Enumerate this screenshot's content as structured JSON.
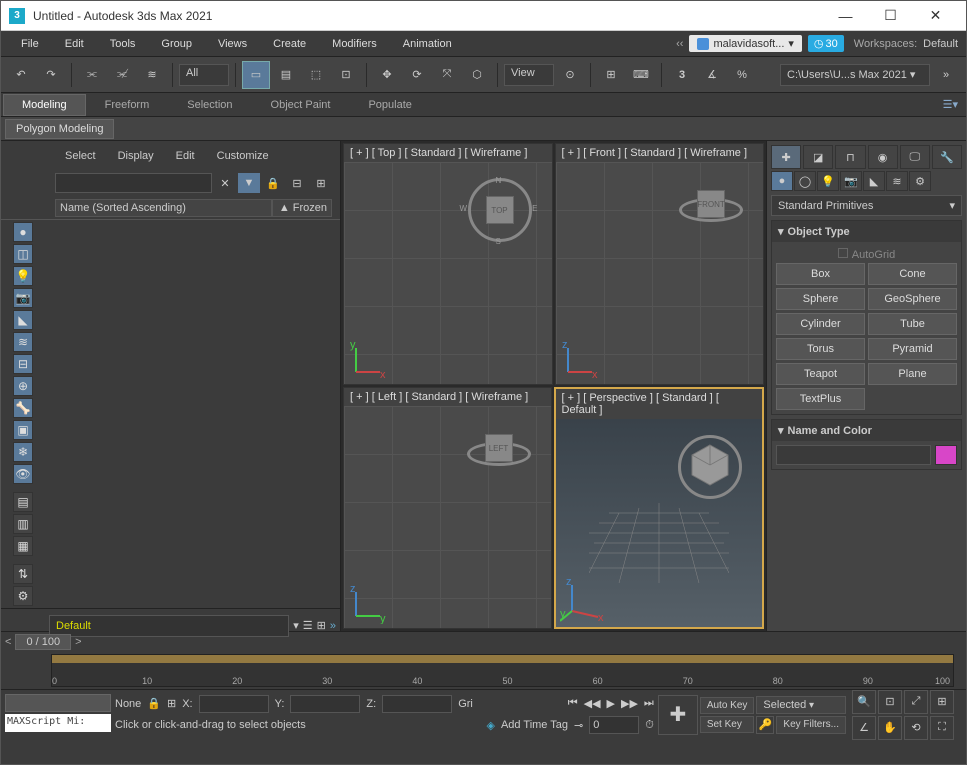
{
  "window": {
    "title": "Untitled - Autodesk 3ds Max 2021"
  },
  "menubar": {
    "items": [
      "File",
      "Edit",
      "Tools",
      "Group",
      "Views",
      "Create",
      "Modifiers",
      "Animation"
    ],
    "user": "malavidasoft...",
    "time": "30",
    "workspaces_label": "Workspaces:",
    "workspace": "Default"
  },
  "toolbar": {
    "selection_set": "All",
    "refcoord": "View",
    "path": "C:\\Users\\U...s Max 2021"
  },
  "ribbon": {
    "tabs": [
      "Modeling",
      "Freeform",
      "Selection",
      "Object Paint",
      "Populate"
    ],
    "active": 0,
    "subtab": "Polygon Modeling"
  },
  "scene_explorer": {
    "menus": [
      "Select",
      "Display",
      "Edit",
      "Customize"
    ],
    "col_name": "Name (Sorted Ascending)",
    "col_frozen": "▲ Frozen",
    "layer": "Default"
  },
  "viewports": {
    "vp": [
      {
        "label": "[ + ] [ Top ] [ Standard ] [ Wireframe ]",
        "cube": "TOP"
      },
      {
        "label": "[ + ] [ Front ] [ Standard ] [ Wireframe ]",
        "cube": "FRONT"
      },
      {
        "label": "[ + ] [ Left ] [ Standard ] [ Wireframe ]",
        "cube": "LEFT"
      },
      {
        "label": "[ + ] [ Perspective ] [ Standard ] [ Default ]",
        "cube": ""
      }
    ]
  },
  "command_panel": {
    "dropdown": "Standard Primitives",
    "rollout_objtype": "Object Type",
    "autogrid": "AutoGrid",
    "primitives": [
      "Box",
      "Cone",
      "Sphere",
      "GeoSphere",
      "Cylinder",
      "Tube",
      "Torus",
      "Pyramid",
      "Teapot",
      "Plane",
      "TextPlus"
    ],
    "rollout_namecolor": "Name and Color",
    "color": "#d846c8"
  },
  "timeline": {
    "pos": "0 / 100",
    "ticks": [
      "0",
      "10",
      "20",
      "30",
      "40",
      "50",
      "60",
      "70",
      "80",
      "90",
      "100"
    ]
  },
  "status": {
    "script": "MAXScript Mi:",
    "none": "None",
    "x": "X:",
    "y": "Y:",
    "z": "Z:",
    "grid": "Gri",
    "prompt": "Click or click-and-drag to select objects",
    "addtag": "Add Time Tag",
    "frame": "0",
    "autokey": "Auto Key",
    "setkey": "Set Key",
    "selected": "Selected",
    "keyfilters": "Key Filters..."
  }
}
